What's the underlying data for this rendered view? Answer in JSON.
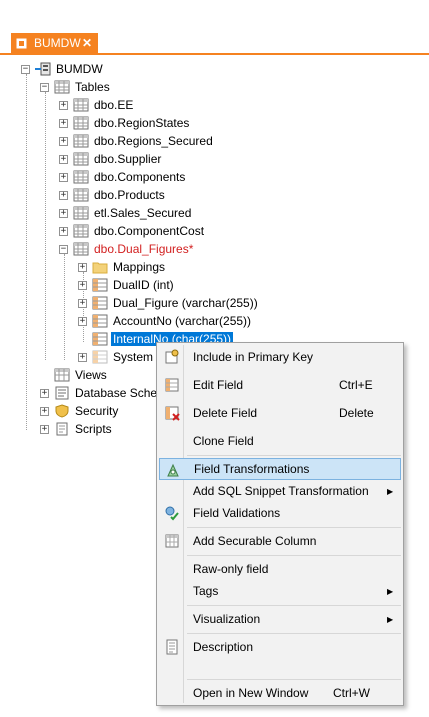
{
  "tab": {
    "title": "BUMDW",
    "close": "✕"
  },
  "tree": {
    "root": "BUMDW",
    "tables_label": "Tables",
    "tables": [
      "dbo.EE",
      "dbo.RegionStates",
      "dbo.Regions_Secured",
      "dbo.Supplier",
      "dbo.Components",
      "dbo.Products",
      "etl.Sales_Secured",
      "dbo.ComponentCost"
    ],
    "dual_figures": "dbo.Dual_Figures*",
    "children": {
      "mappings": "Mappings",
      "dualid": "DualID (int)",
      "dual_figure": "Dual_Figure (varchar(255))",
      "accountno": "AccountNo (varchar(255))",
      "internalno": "InternalNo (char(255))",
      "system": "System F"
    },
    "views": "Views",
    "database_schema": "Database Schem",
    "security": "Security",
    "scripts": "Scripts"
  },
  "context_menu": {
    "include_pk": "Include in Primary Key",
    "edit_field": "Edit Field",
    "edit_field_shortcut": "Ctrl+E",
    "delete_field": "Delete Field",
    "delete_field_shortcut": "Delete",
    "clone_field": "Clone Field",
    "field_transformations": "Field Transformations",
    "add_sql_snippet": "Add SQL Snippet Transformation",
    "field_validations": "Field Validations",
    "add_securable": "Add Securable Column",
    "raw_only": "Raw-only field",
    "tags": "Tags",
    "visualization": "Visualization",
    "description": "Description",
    "open_new_window": "Open in New Window",
    "open_new_window_shortcut": "Ctrl+W"
  },
  "colors": {
    "accent": "#f58220",
    "selection": "#0078d7",
    "highlight": "#cce4f7",
    "modified": "#d21f1f"
  },
  "icons": [
    "database-icon",
    "table-folder-icon",
    "table-icon",
    "folder-icon",
    "column-icon",
    "key-icon",
    "views-icon",
    "schema-icon",
    "shield-icon",
    "scripts-icon"
  ]
}
